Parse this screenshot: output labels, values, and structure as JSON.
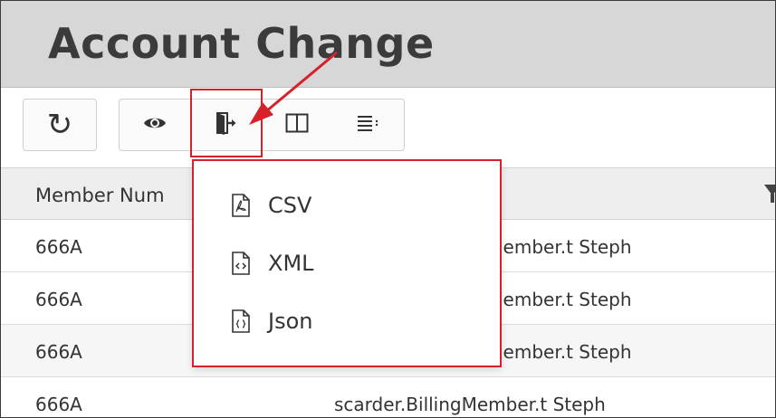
{
  "page": {
    "title": "Account Change"
  },
  "toolbar": {
    "refresh_icon": "refresh-icon",
    "view_icon": "eye-icon",
    "export_icon": "export-icon",
    "columns_icon": "columns-icon",
    "more_icon": "list-options-icon"
  },
  "export_menu": {
    "items": [
      {
        "label": "CSV",
        "icon": "pdf-file-icon"
      },
      {
        "label": "XML",
        "icon": "xml-file-icon"
      },
      {
        "label": "Json",
        "icon": "json-file-icon"
      }
    ]
  },
  "table": {
    "columns": [
      "Member Num"
    ],
    "rows": [
      {
        "member_num": "666A",
        "name": "lember.t Steph"
      },
      {
        "member_num": "666A",
        "name": "lember.t Steph"
      },
      {
        "member_num": "666A",
        "name": "lember.t Steph"
      },
      {
        "member_num": "666A",
        "name": "scarder.BillingMember.t Steph"
      }
    ]
  },
  "colors": {
    "highlight": "#d6202a",
    "header_bg": "#d7d7d7",
    "title_text": "#3b3b3b"
  }
}
